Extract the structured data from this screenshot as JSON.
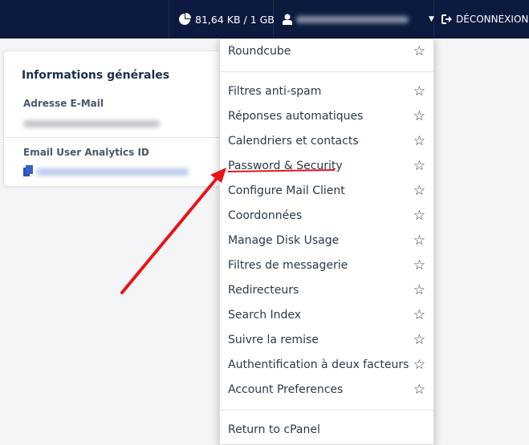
{
  "navbar": {
    "quota": "81,64 KB / 1 GB",
    "quota_icon": "pie-chart-icon",
    "user_icon": "user-icon",
    "user_name_blurred": true,
    "logout": "DÉCONNEXION",
    "logout_icon": "sign-out-icon"
  },
  "card": {
    "title": "Informations générales",
    "email_label": "Adresse E-Mail",
    "analytics_label": "Email User Analytics ID",
    "copy_icon": "copy-icon"
  },
  "menu": {
    "top": {
      "label": "Roundcube"
    },
    "items": [
      {
        "label": "Filtres anti-spam"
      },
      {
        "label": "Réponses automatiques"
      },
      {
        "label": "Calendriers et contacts"
      },
      {
        "label": "Password & Security"
      },
      {
        "label": "Configure Mail Client"
      },
      {
        "label": "Coordonnées"
      },
      {
        "label": "Manage Disk Usage"
      },
      {
        "label": "Filtres de messagerie"
      },
      {
        "label": "Redirecteurs"
      },
      {
        "label": "Search Index"
      },
      {
        "label": "Suivre la remise"
      },
      {
        "label": "Authentification à deux facteurs"
      },
      {
        "label": "Account Preferences"
      }
    ],
    "bottom": {
      "label": "Return to cPanel"
    },
    "star_icon": "star-outline-icon"
  },
  "annotation": {
    "color": "#e8141b",
    "target": "Password & Security"
  }
}
